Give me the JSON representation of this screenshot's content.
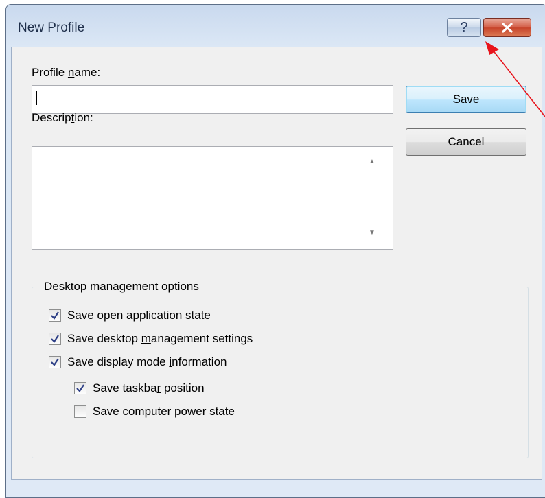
{
  "window": {
    "title": "New Profile",
    "help_glyph": "?"
  },
  "form": {
    "profile_name_label": "Profile name:",
    "profile_name_value": "",
    "description_label": "Description:",
    "description_value": ""
  },
  "buttons": {
    "save": "Save",
    "cancel": "Cancel"
  },
  "group": {
    "title": "Desktop management options",
    "options": [
      {
        "label": "Save open application state",
        "checked": true
      },
      {
        "label": "Save desktop management settings",
        "checked": true
      },
      {
        "label": "Save display mode information",
        "checked": true
      },
      {
        "label": "Save taskbar position",
        "checked": true
      },
      {
        "label": "Save computer power state",
        "checked": false
      }
    ]
  },
  "annotation": {
    "arrow_color": "#ff0000"
  }
}
